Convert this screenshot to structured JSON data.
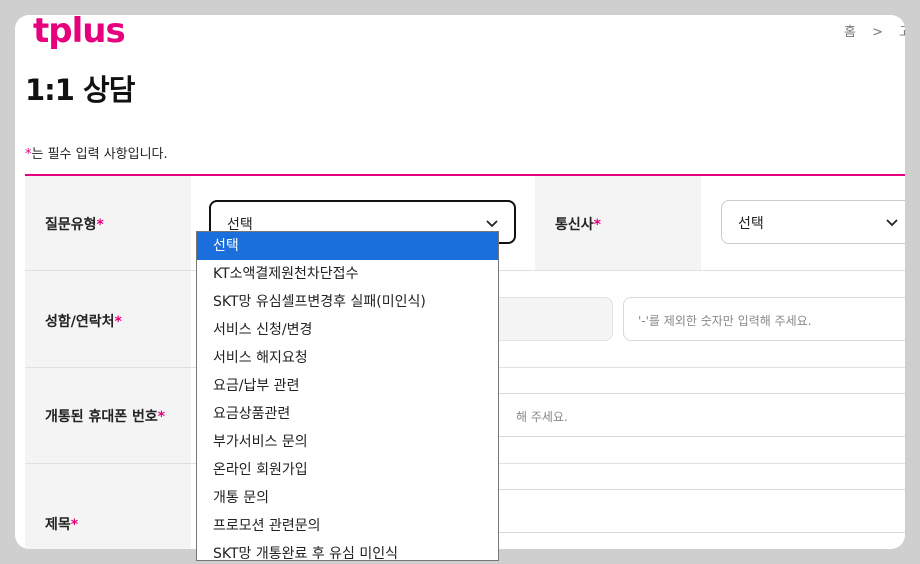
{
  "brand": {
    "logo_text": "tplus",
    "color": "#e6007e"
  },
  "breadcrumb": {
    "home": "홈",
    "separator": ">",
    "current": "고객"
  },
  "page": {
    "title": "1:1 상담"
  },
  "notice": {
    "star": "*",
    "text": "는 필수 입력 사항입니다."
  },
  "form": {
    "question_type": {
      "label": "질문유형",
      "star": "*",
      "value": "선택"
    },
    "carrier": {
      "label": "통신사",
      "star": "*",
      "value": "선택"
    },
    "name_contact": {
      "label": "성함/연락처",
      "star": "*",
      "phone_placeholder": "'-'를 제외한 숫자만 입력해 주세요."
    },
    "activated_phone": {
      "label": "개통된 휴대폰 번호",
      "star": "*",
      "hint_tail": "해 주세요."
    },
    "subject": {
      "label": "제목",
      "star": "*"
    }
  },
  "dropdown": {
    "options": [
      "선택",
      "KT소액결제원천차단접수",
      "SKT망 유심셀프변경후 실패(미인식)",
      "서비스 신청/변경",
      "서비스 해지요청",
      "요금/납부 관련",
      "요금상품관련",
      "부가서비스 문의",
      "온라인 회원가입",
      "개통 문의",
      "프로모션 관련문의",
      "SKT망 개통완료 후 유심 미인식"
    ],
    "selected_index": 0,
    "highlight_color": "#1a6fdc"
  }
}
